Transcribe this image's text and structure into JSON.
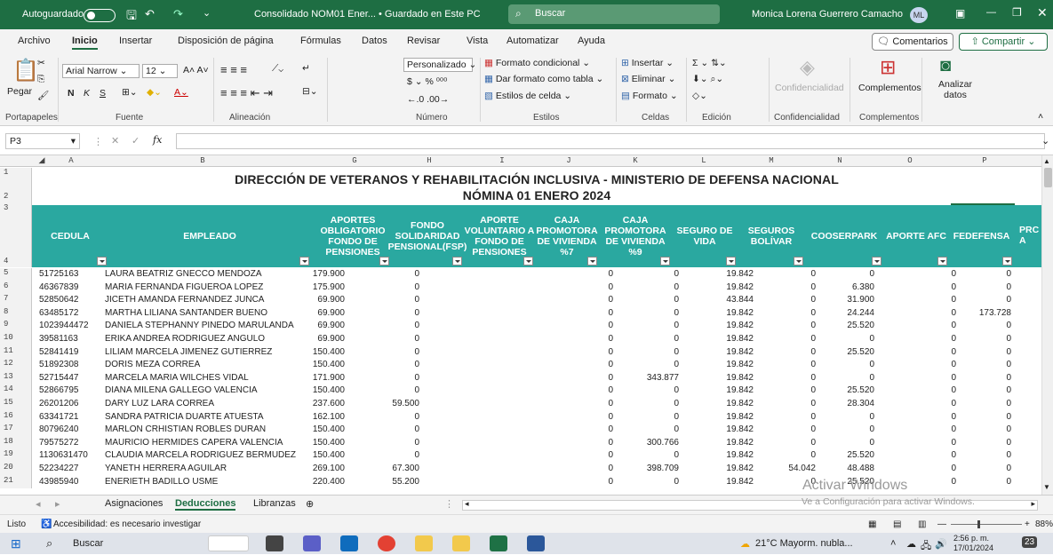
{
  "titlebar": {
    "autosave": "Autoguardado",
    "filename": "Consolidado NOM01 Ener... • Guardado en Este PC",
    "search": "Buscar",
    "user": "Monica Lorena Guerrero Camacho",
    "initials": "ML"
  },
  "menu": [
    "Archivo",
    "Inicio",
    "Insertar",
    "Disposición de página",
    "Fórmulas",
    "Datos",
    "Revisar",
    "Vista",
    "Automatizar",
    "Ayuda"
  ],
  "comments_label": "Comentarios",
  "share_label": "Compartir",
  "ribbon": {
    "paste": "Pegar",
    "font_name": "Arial Narrow",
    "font_size": "12",
    "number_format": "Personalizado",
    "cond_format": "Formato condicional",
    "table_format": "Dar formato como tabla",
    "cell_styles": "Estilos de celda",
    "insert": "Insertar",
    "delete": "Eliminar",
    "format": "Formato",
    "confidentiality": "Confidencialidad",
    "addins": "Complementos",
    "analyze": "Analizar datos",
    "groups": [
      "Portapapeles",
      "Fuente",
      "Alineación",
      "Número",
      "Estilos",
      "Celdas",
      "Edición",
      "Confidencialidad",
      "Complementos"
    ]
  },
  "formula_bar": {
    "cell_ref": "P3",
    "fx": "fx",
    "value": ""
  },
  "columns": [
    "A",
    "B",
    "G",
    "H",
    "I",
    "J",
    "K",
    "L",
    "M",
    "N",
    "O",
    "P"
  ],
  "sheet": {
    "title1": "DIRECCIÓN DE VETERANOS Y REHABILITACIÓN INCLUSIVA - MINISTERIO DE DEFENSA NACIONAL",
    "title2": "NÓMINA 01 ENERO 2024",
    "headers": [
      "CEDULA",
      "EMPLEADO",
      "APORTES OBLIGATORIO FONDO DE PENSIONES",
      "FONDO SOLIDARIDAD PENSIONAL(FSP)",
      "APORTE VOLUNTARIO A FONDO DE PENSIONES",
      "CAJA PROMOTORA DE VIVIENDA %7",
      "CAJA PROMOTORA DE VIVIENDA %9",
      "SEGURO DE VIDA",
      "SEGUROS BOLÍVAR",
      "COOSERPARK",
      "APORTE AFC",
      "FEDEFENSA",
      "PRC A"
    ],
    "rows": [
      [
        "5",
        "51725163",
        "LAURA BEATRIZ GNECCO MENDOZA",
        "179.900",
        "0",
        "",
        "0",
        "0",
        "19.842",
        "0",
        "0",
        "0",
        "0"
      ],
      [
        "6",
        "46367839",
        "MARIA FERNANDA FIGUEROA LOPEZ",
        "175.900",
        "0",
        "",
        "0",
        "0",
        "19.842",
        "0",
        "6.380",
        "0",
        "0"
      ],
      [
        "7",
        "52850642",
        "JICETH AMANDA FERNANDEZ JUNCA",
        "69.900",
        "0",
        "",
        "0",
        "0",
        "43.844",
        "0",
        "31.900",
        "0",
        "0"
      ],
      [
        "8",
        "63485172",
        "MARTHA LILIANA SANTANDER BUENO",
        "69.900",
        "0",
        "",
        "0",
        "0",
        "19.842",
        "0",
        "24.244",
        "0",
        "173.728"
      ],
      [
        "9",
        "1023944472",
        "DANIELA STEPHANNY PINEDO MARULANDA",
        "69.900",
        "0",
        "",
        "0",
        "0",
        "19.842",
        "0",
        "25.520",
        "0",
        "0"
      ],
      [
        "10",
        "39581163",
        "ERIKA ANDREA RODRIGUEZ ANGULO",
        "69.900",
        "0",
        "",
        "0",
        "0",
        "19.842",
        "0",
        "0",
        "0",
        "0"
      ],
      [
        "11",
        "52841419",
        "LILIAM MARCELA JIMENEZ GUTIERREZ",
        "150.400",
        "0",
        "",
        "0",
        "0",
        "19.842",
        "0",
        "25.520",
        "0",
        "0"
      ],
      [
        "12",
        "51892308",
        "DORIS MEZA CORREA",
        "150.400",
        "0",
        "",
        "0",
        "0",
        "19.842",
        "0",
        "0",
        "0",
        "0"
      ],
      [
        "13",
        "52715447",
        "MARCELA MARIA WILCHES VIDAL",
        "171.900",
        "0",
        "",
        "0",
        "343.877",
        "19.842",
        "0",
        "0",
        "0",
        "0"
      ],
      [
        "14",
        "52866795",
        "DIANA MILENA GALLEGO VALENCIA",
        "150.400",
        "0",
        "",
        "0",
        "0",
        "19.842",
        "0",
        "25.520",
        "0",
        "0"
      ],
      [
        "15",
        "26201206",
        "DARY LUZ LARA CORREA",
        "237.600",
        "59.500",
        "",
        "0",
        "0",
        "19.842",
        "0",
        "28.304",
        "0",
        "0"
      ],
      [
        "16",
        "63341721",
        "SANDRA PATRICIA DUARTE ATUESTA",
        "162.100",
        "0",
        "",
        "0",
        "0",
        "19.842",
        "0",
        "0",
        "0",
        "0"
      ],
      [
        "17",
        "80796240",
        "MARLON CRHISTIAN ROBLES DURAN",
        "150.400",
        "0",
        "",
        "0",
        "0",
        "19.842",
        "0",
        "0",
        "0",
        "0"
      ],
      [
        "18",
        "79575272",
        "MAURICIO HERMIDES CAPERA VALENCIA",
        "150.400",
        "0",
        "",
        "0",
        "300.766",
        "19.842",
        "0",
        "0",
        "0",
        "0"
      ],
      [
        "19",
        "1130631470",
        "CLAUDIA MARCELA RODRIGUEZ BERMUDEZ",
        "150.400",
        "0",
        "",
        "0",
        "0",
        "19.842",
        "0",
        "25.520",
        "0",
        "0"
      ],
      [
        "20",
        "52234227",
        "YANETH HERRERA AGUILAR",
        "269.100",
        "67.300",
        "",
        "0",
        "398.709",
        "19.842",
        "54.042",
        "48.488",
        "0",
        "0"
      ],
      [
        "21",
        "43985940",
        "ENERIETH BADILLO USME",
        "220.400",
        "55.200",
        "",
        "0",
        "0",
        "19.842",
        "0",
        "25.520",
        "0",
        "0"
      ]
    ]
  },
  "tabs": [
    "Asignaciones",
    "Deducciones",
    "Libranzas"
  ],
  "status": {
    "ready": "Listo",
    "accessibility": "Accesibilidad: es necesario investigar",
    "zoom": "88%"
  },
  "watermark": {
    "line1": "Activar Windows",
    "line2": "Ve a Configuración para activar Windows."
  },
  "taskbar": {
    "search": "Buscar",
    "weather": "21°C  Mayorm. nubla...",
    "time": "2:56 p. m.",
    "date": "17/01/2024",
    "notif": "23"
  }
}
